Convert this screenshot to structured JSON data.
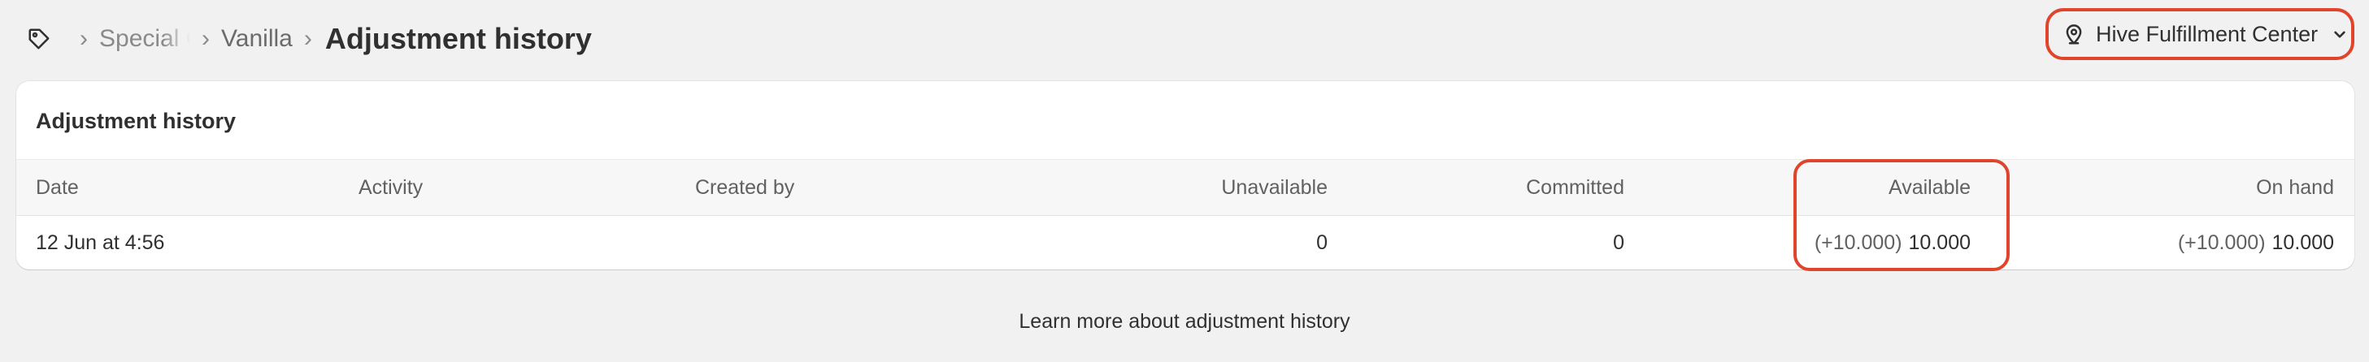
{
  "breadcrumb": {
    "icon": "tag-icon",
    "items": [
      "Special C",
      "Vanilla"
    ],
    "current": "Adjustment history"
  },
  "location": {
    "icon": "location-pin-icon",
    "label": "Hive Fulfillment Center",
    "chevron": "chevron-down-icon"
  },
  "card": {
    "title": "Adjustment history",
    "columns": [
      "Date",
      "Activity",
      "Created by",
      "Unavailable",
      "Committed",
      "Available",
      "On hand"
    ],
    "rows": [
      {
        "date": "12 Jun at 4:56",
        "activity": "",
        "created_by": "",
        "unavailable": "0",
        "committed": "0",
        "available_delta": "(+10.000)",
        "available": "10.000",
        "on_hand_delta": "(+10.000)",
        "on_hand": "10.000"
      }
    ]
  },
  "footer": {
    "link": "Learn more about adjustment history"
  },
  "colors": {
    "highlight": "#e0452b",
    "background": "#f1f1f1"
  }
}
